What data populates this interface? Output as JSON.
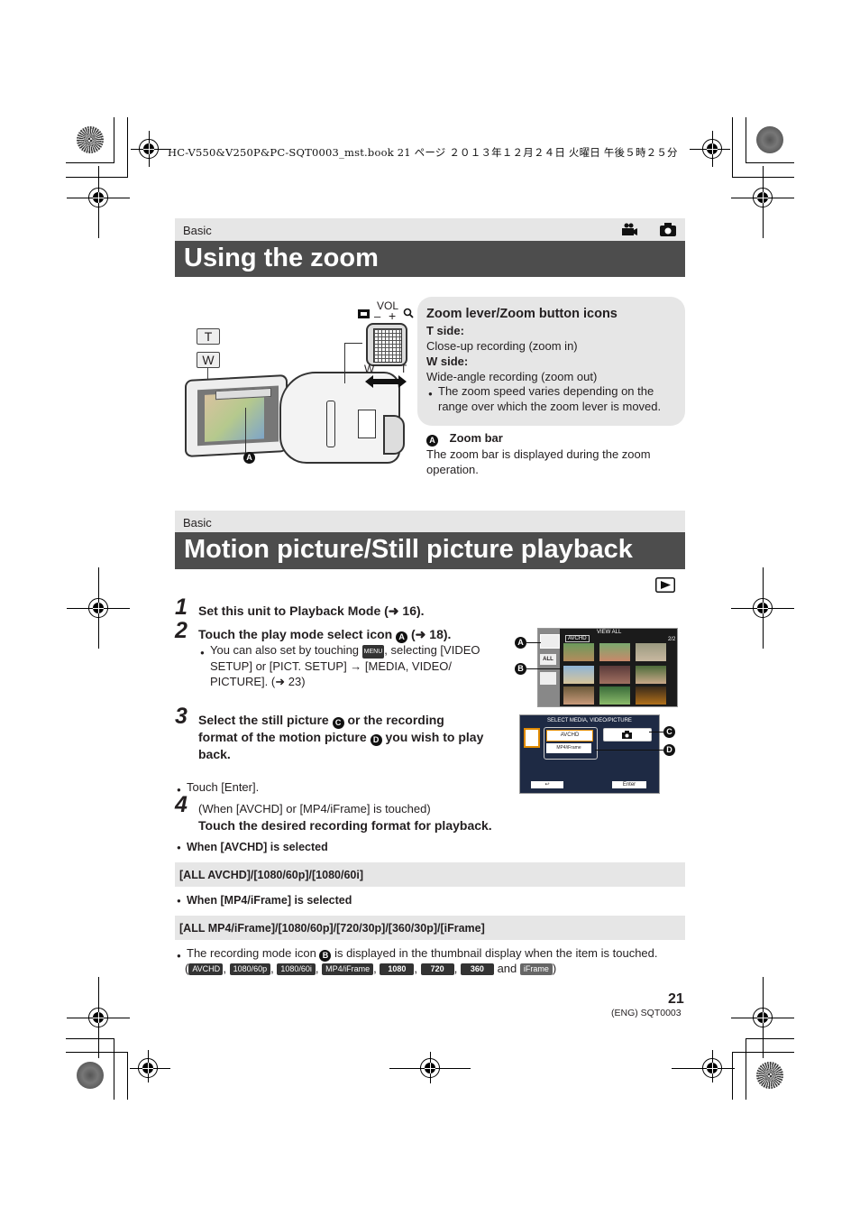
{
  "print_header": "HC-V550&V250P&PC-SQT0003_mst.book  21 ページ  ２０１３年１２月２４日  火曜日  午後５時２５分",
  "section1": {
    "category": "Basic",
    "title": "Using the zoom",
    "mode_icons": [
      "movie-camera-icon",
      "still-camera-icon"
    ],
    "illustration": {
      "button_T": "T",
      "button_W": "W",
      "lever_label_vol": "VOL",
      "lever_minus": "–",
      "lever_plus": "+",
      "lever_W": "W",
      "lever_T": "T",
      "callout_A": "A"
    },
    "infobox": {
      "heading": "Zoom lever/Zoom button icons",
      "t_side_label": "T side:",
      "t_side_text": "Close-up recording (zoom in)",
      "w_side_label": "W side:",
      "w_side_text": "Wide-angle recording (zoom out)",
      "bullet": "The zoom speed varies depending on the range over which the zoom lever is moved."
    },
    "note": {
      "marker": "A",
      "title": "Zoom bar",
      "text": "The zoom bar is displayed during the zoom operation."
    }
  },
  "section2": {
    "category": "Basic",
    "title": "Motion picture/Still picture playback",
    "mode_icon": "play-mode-icon",
    "steps": [
      {
        "num": "1",
        "text": "Set this unit to Playback Mode (➜ 16)."
      },
      {
        "num": "2",
        "text_pre": "Touch the play mode select icon",
        "marker": "A",
        "text_post": "(➜ 18).",
        "bullet_pre": "You can also set by touching",
        "bullet_icon": "MENU",
        "bullet_post": ", selecting [VIDEO SETUP] or [PICT. SETUP] → [MEDIA, VIDEO/ PICTURE]. (➜ 23)"
      },
      {
        "num": "3",
        "text_a": "Select the still picture",
        "marker_c": "C",
        "text_b": "or the recording format of the motion picture",
        "marker_d": "D",
        "text_c": "you wish to play back.",
        "bullet": "Touch [Enter]."
      },
      {
        "num": "4",
        "sub": "(When [AVCHD] or [MP4/iFrame] is touched)",
        "text": "Touch the desired recording format for playback."
      }
    ],
    "screen1": {
      "title": "VIEW ALL",
      "page": "2/2",
      "format_tag": "AVCHD",
      "all_button": "ALL",
      "callouts": [
        "A",
        "B"
      ],
      "thumb_labels": [
        "HG",
        "HG",
        "PH",
        "PH",
        "PH",
        "HA",
        "HE",
        "HE"
      ]
    },
    "screen2": {
      "title": "SELECT MEDIA, VIDEO/PICTURE",
      "avchd_button": "AVCHD",
      "mp4_button": "MP4/iFrame",
      "back_button": "↩",
      "enter_button": "Enter",
      "callouts": [
        "C",
        "D"
      ]
    },
    "avchd_note": "When [AVCHD] is selected",
    "avchd_options": "[ALL AVCHD]/[1080/60p]/[1080/60i]",
    "mp4_note": "When [MP4/iFrame] is selected",
    "mp4_options": "[ALL MP4/iFrame]/[1080/60p]/[720/30p]/[360/30p]/[iFrame]",
    "final_bullet_pre": "The recording mode icon",
    "final_marker": "B",
    "final_bullet_post": "is displayed in the thumbnail display when the item is touched.",
    "badges": [
      "AVCHD",
      "1080/60p",
      "1080/60i",
      "MP4/iFrame",
      "1080",
      "720",
      "360",
      "iFrame"
    ],
    "and_word": "and"
  },
  "footer": {
    "page_number": "21",
    "code": "(ENG) SQT0003"
  }
}
